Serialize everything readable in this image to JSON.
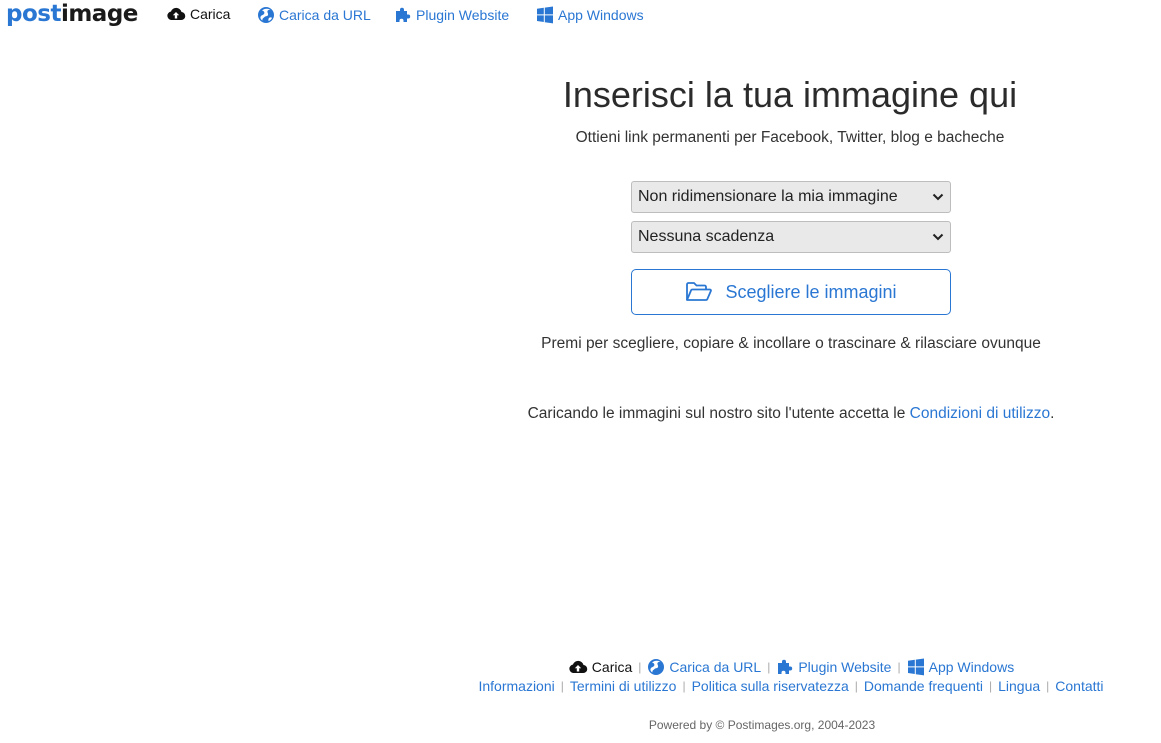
{
  "logo": {
    "part1": "post",
    "part2": "image"
  },
  "nav": {
    "upload": "Carica",
    "url_upload": "Carica da URL",
    "plugin": "Plugin Website",
    "app": "App Windows"
  },
  "hero": {
    "title": "Inserisci la tua immagine qui",
    "subtitle": "Ottieni link permanenti per Facebook, Twitter, blog e bacheche"
  },
  "form": {
    "resize_select": "Non ridimensionare la mia immagine",
    "expiry_select": "Nessuna scadenza",
    "choose_button": "Scegliere le immagini",
    "hint": "Premi per scegliere, copiare & incollare o trascinare & rilasciare ovunque"
  },
  "terms": {
    "prefix": "Caricando le immagini sul nostro sito l'utente accetta le ",
    "link": "Condizioni di utilizzo",
    "suffix": "."
  },
  "footer": {
    "upload": "Carica",
    "url_upload": "Carica da URL",
    "plugin": "Plugin Website",
    "app": "App Windows",
    "links": [
      "Informazioni",
      "Termini di utilizzo",
      "Politica sulla riservatezza",
      "Domande frequenti",
      "Lingua",
      "Contatti"
    ],
    "separator": "|",
    "powered": "Powered by © Postimages.org, 2004-2023"
  },
  "colors": {
    "accent": "#2a77d3",
    "select_bg": "#e9e9e9"
  },
  "icons": [
    "cloud-upload-icon",
    "globe-icon",
    "puzzle-icon",
    "windows-icon",
    "chevron-down-icon",
    "folder-open-icon"
  ]
}
